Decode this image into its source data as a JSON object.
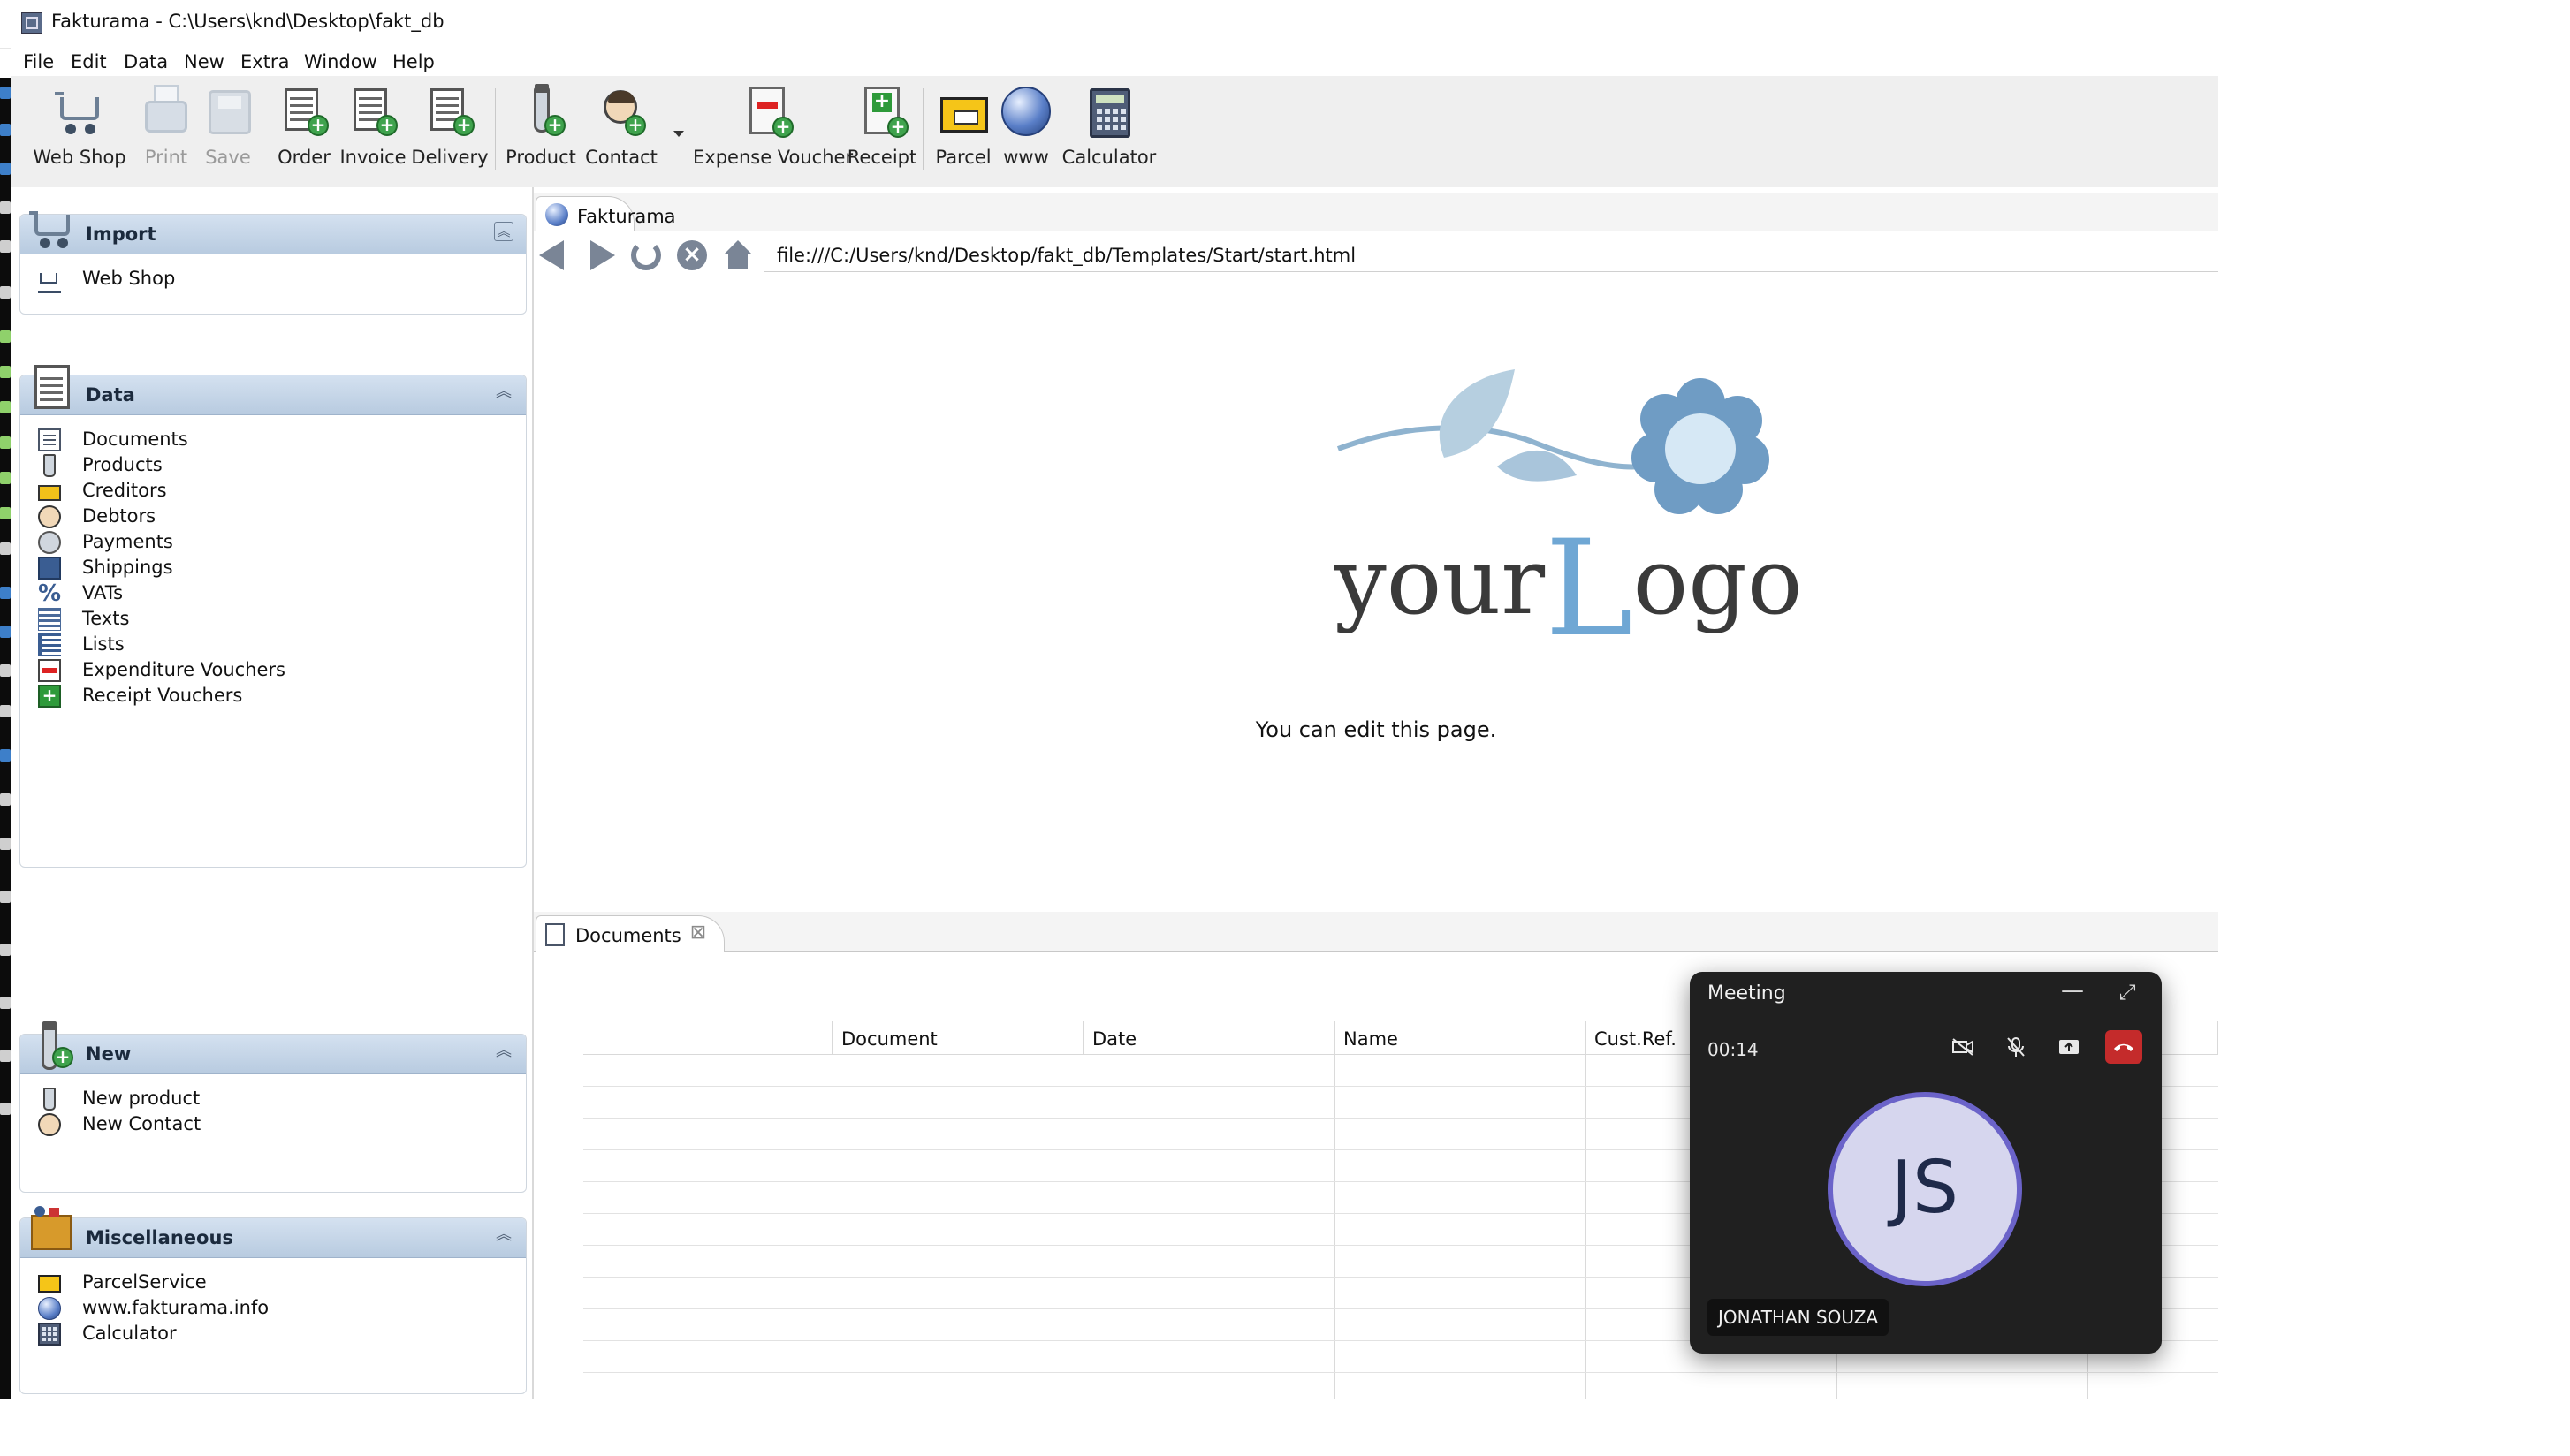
{
  "window": {
    "title": "Fakturama - C:\\Users\\knd\\Desktop\\fakt_db"
  },
  "menu": [
    "File",
    "Edit",
    "Data",
    "New",
    "Extra",
    "Window",
    "Help"
  ],
  "toolbar": {
    "web_shop": "Web Shop",
    "print": "Print",
    "save": "Save",
    "order": "Order",
    "invoice": "Invoice",
    "delivery": "Delivery",
    "product": "Product",
    "contact": "Contact",
    "expense_voucher": "Expense Voucher",
    "receipt": "Receipt",
    "parcel": "Parcel",
    "www": "www",
    "calculator": "Calculator"
  },
  "sections": {
    "import": {
      "title": "Import",
      "items": [
        "Web Shop"
      ]
    },
    "data": {
      "title": "Data",
      "items": [
        "Documents",
        "Products",
        "Creditors",
        "Debtors",
        "Payments",
        "Shippings",
        "VATs",
        "Texts",
        "Lists",
        "Expenditure Vouchers",
        "Receipt Vouchers"
      ]
    },
    "new": {
      "title": "New",
      "items": [
        "New product",
        "New Contact"
      ]
    },
    "misc": {
      "title": "Miscellaneous",
      "items": [
        "ParcelService",
        "www.fakturama.info",
        "Calculator"
      ]
    }
  },
  "browser": {
    "tab": "Fakturama",
    "url": "file:///C:/Users/knd/Desktop/fakt_db/Templates/Start/start.html",
    "edit_text": "You can edit this page.",
    "logo_text_a": "your",
    "logo_text_b": "L",
    "logo_text_c": "ogo"
  },
  "documents": {
    "tab": "Documents",
    "columns": [
      "",
      "Document",
      "Date",
      "Name",
      "Cust.Ref.",
      "",
      ""
    ]
  },
  "meeting": {
    "title": "Meeting",
    "timer": "00:14",
    "initials": "JS",
    "participant": "JONATHAN SOUZA"
  },
  "colors": {
    "section_header": "#c6d6e8",
    "end_call": "#c42b2b",
    "avatar_ring": "#6b63c9",
    "logo_blue": "#6f9cc4"
  }
}
